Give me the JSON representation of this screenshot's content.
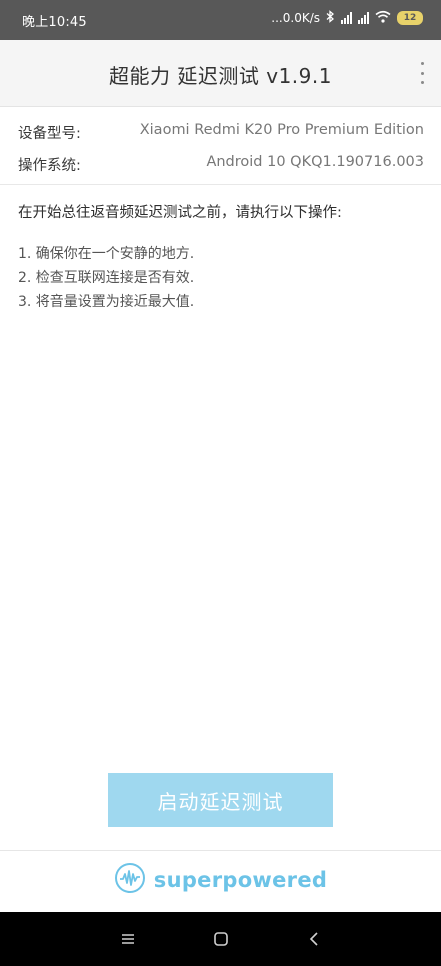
{
  "status_bar": {
    "time": "晚上10:45",
    "network_speed": "...0.0K/s",
    "battery_level": "12",
    "icons": [
      "bluetooth-icon",
      "signal-hd-icon",
      "signal-hd-icon",
      "wifi-icon",
      "battery-icon"
    ]
  },
  "app_bar": {
    "title": "超能力 延迟测试 v1.9.1",
    "overflow_icon": "more-vert-icon"
  },
  "device_info": {
    "model_label": "设备型号:",
    "model_value": "Xiaomi Redmi K20 Pro Premium Edition",
    "os_label": "操作系统:",
    "os_value": "Android 10 QKQ1.190716.003"
  },
  "instructions": {
    "intro": "在开始总往返音频延迟测试之前，请执行以下操作:",
    "steps": [
      "1. 确保你在一个安静的地方.",
      "2. 检查互联网连接是否有效.",
      "3. 将音量设置为接近最大值."
    ]
  },
  "start_button": {
    "label": "启动延迟测试"
  },
  "footer": {
    "brand": "superpowered",
    "logo_icon": "superpowered-logo-icon"
  },
  "nav_bar": {
    "icons": [
      "menu-icon",
      "home-icon",
      "back-icon"
    ]
  },
  "colors": {
    "status_bar_bg": "#585858",
    "app_bar_bg": "#f5f5f5",
    "button_bg": "#9fd8ef",
    "brand": "#6cc3e7",
    "nav_bar_bg": "#000000"
  }
}
